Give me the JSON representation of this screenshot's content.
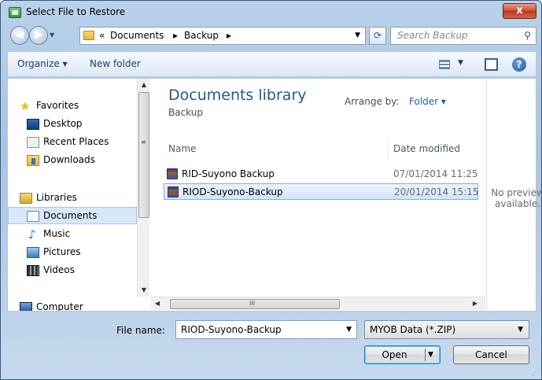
{
  "window": {
    "title": "Select File to Restore",
    "close_glyph": "x"
  },
  "nav": {
    "breadcrumb": {
      "overflow": "«",
      "items": [
        "Documents",
        "Backup"
      ],
      "separator": "▸"
    },
    "search": {
      "placeholder": "Search Backup"
    }
  },
  "toolbar": {
    "organize_label": "Organize ▾",
    "new_folder_label": "New folder",
    "help_glyph": "?"
  },
  "sidebar": {
    "items": [
      {
        "label": "Favorites",
        "icon": "star-icon"
      },
      {
        "label": "Desktop",
        "icon": "desktop-icon"
      },
      {
        "label": "Recent Places",
        "icon": "recent-places-icon"
      },
      {
        "label": "Downloads",
        "icon": "downloads-icon"
      },
      {
        "label": "Libraries",
        "icon": "libraries-icon"
      },
      {
        "label": "Documents",
        "icon": "documents-icon",
        "selected": true
      },
      {
        "label": "Music",
        "icon": "music-icon"
      },
      {
        "label": "Pictures",
        "icon": "pictures-icon"
      },
      {
        "label": "Videos",
        "icon": "videos-icon"
      },
      {
        "label": "Computer",
        "icon": "computer-icon"
      }
    ]
  },
  "library": {
    "title": "Documents library",
    "subtitle": "Backup",
    "arrange_label": "Arrange by:",
    "arrange_value": "Folder ▾"
  },
  "columns": {
    "name": "Name",
    "date": "Date modified"
  },
  "files": [
    {
      "name": "RID-Suyono Backup",
      "date": "07/01/2014 11:25",
      "selected": false
    },
    {
      "name": "RIOD-Suyono-Backup",
      "date": "20/01/2014 15:15",
      "selected": true
    }
  ],
  "preview": {
    "text_line1": "No preview",
    "text_line2": "available."
  },
  "footer": {
    "file_name_label": "File name:",
    "file_name_value": "RIOD-Suyono-Backup",
    "file_type_value": "MYOB Data (*.ZIP)",
    "open_label": "Open",
    "cancel_label": "Cancel"
  },
  "colors": {
    "accent": "#1e5b8a",
    "selection": "#d3e6fb"
  }
}
